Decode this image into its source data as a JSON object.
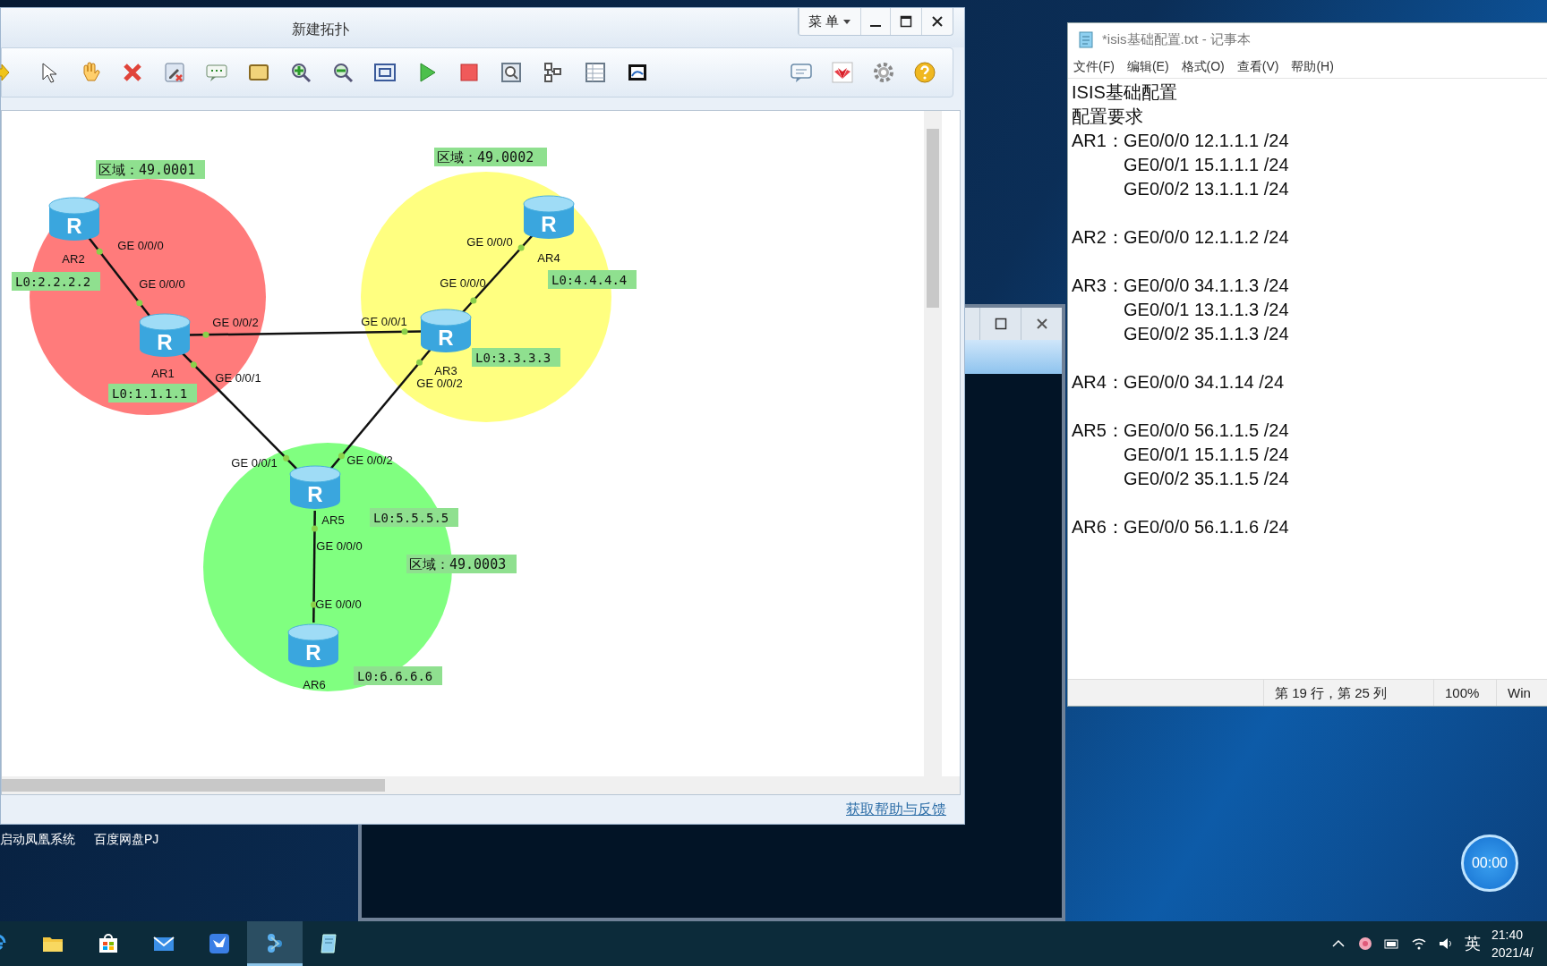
{
  "topology_window": {
    "title": "新建拓扑",
    "menu_button": "菜 单",
    "areas": [
      {
        "label": "区域：49.0001",
        "color": "#ff7b7b"
      },
      {
        "label": "区域：49.0002",
        "color": "#ffff80"
      },
      {
        "label": "区域：49.0003",
        "color": "#80ff80"
      }
    ],
    "routers": [
      {
        "name": "AR1",
        "icon_letter": "R",
        "loopback": "L0:1.1.1.1"
      },
      {
        "name": "AR2",
        "icon_letter": "R",
        "loopback": "L0:2.2.2.2"
      },
      {
        "name": "AR3",
        "icon_letter": "R",
        "loopback": "L0:3.3.3.3"
      },
      {
        "name": "AR4",
        "icon_letter": "R",
        "loopback": "L0:4.4.4.4"
      },
      {
        "name": "AR5",
        "icon_letter": "R",
        "loopback": "L0:5.5.5.5"
      },
      {
        "name": "AR6",
        "icon_letter": "R",
        "loopback": "L0:6.6.6.6"
      }
    ],
    "links": [
      {
        "ports": [
          "GE 0/0/0",
          "GE 0/0/0"
        ]
      },
      {
        "ports": [
          "GE 0/0/2",
          "GE 0/0/1"
        ]
      },
      {
        "ports": [
          "GE 0/0/1",
          "GE 0/0/1"
        ]
      },
      {
        "ports": [
          "GE 0/0/2",
          "GE 0/0/2"
        ]
      },
      {
        "ports": [
          "GE 0/0/0",
          "GE 0/0/0"
        ]
      },
      {
        "ports": [
          "GE 0/0/0",
          "GE 0/0/0"
        ]
      }
    ],
    "help_link": "获取帮助与反馈"
  },
  "notepad": {
    "title": "*isis基础配置.txt - 记事本",
    "menu": [
      "文件(F)",
      "编辑(E)",
      "格式(O)",
      "查看(V)",
      "帮助(H)"
    ],
    "heading_lines": [
      "ISIS基础配置",
      "配置要求"
    ],
    "blocks": [
      {
        "router": "AR1：",
        "entries": [
          "GE0/0/0 12.1.1.1 /24",
          "GE0/0/1 15.1.1.1 /24",
          "GE0/0/2 13.1.1.1 /24"
        ]
      },
      {
        "router": "AR2：",
        "entries": [
          "GE0/0/0 12.1.1.2 /24"
        ]
      },
      {
        "router": "AR3：",
        "entries": [
          "GE0/0/0 34.1.1.3 /24",
          "GE0/0/1 13.1.1.3 /24",
          "GE0/0/2 35.1.1.3 /24"
        ]
      },
      {
        "router": "AR4：",
        "entries": [
          "GE0/0/0 34.1.14 /24"
        ]
      },
      {
        "router": "AR5：",
        "entries": [
          "GE0/0/0 56.1.1.5 /24",
          "GE0/0/1 15.1.1.5 /24",
          "GE0/0/2 35.1.1.5 /24"
        ]
      },
      {
        "router": "AR6：",
        "entries": [
          "GE0/0/0 56.1.1.6 /24"
        ]
      }
    ],
    "status": [
      "第 19 行，第 25 列",
      "100%",
      "Win"
    ]
  },
  "desktop_icons": [
    "启动凤凰系统",
    "百度网盘PJ"
  ],
  "timer": "00:00",
  "taskbar": {
    "apps": [
      {
        "selected": false
      },
      {
        "selected": false
      },
      {
        "selected": false
      },
      {
        "selected": false
      },
      {
        "selected": false
      },
      {
        "selected": true
      },
      {
        "selected": false
      }
    ],
    "input_method": "英",
    "time": "21:40",
    "date": "2021/4/"
  }
}
